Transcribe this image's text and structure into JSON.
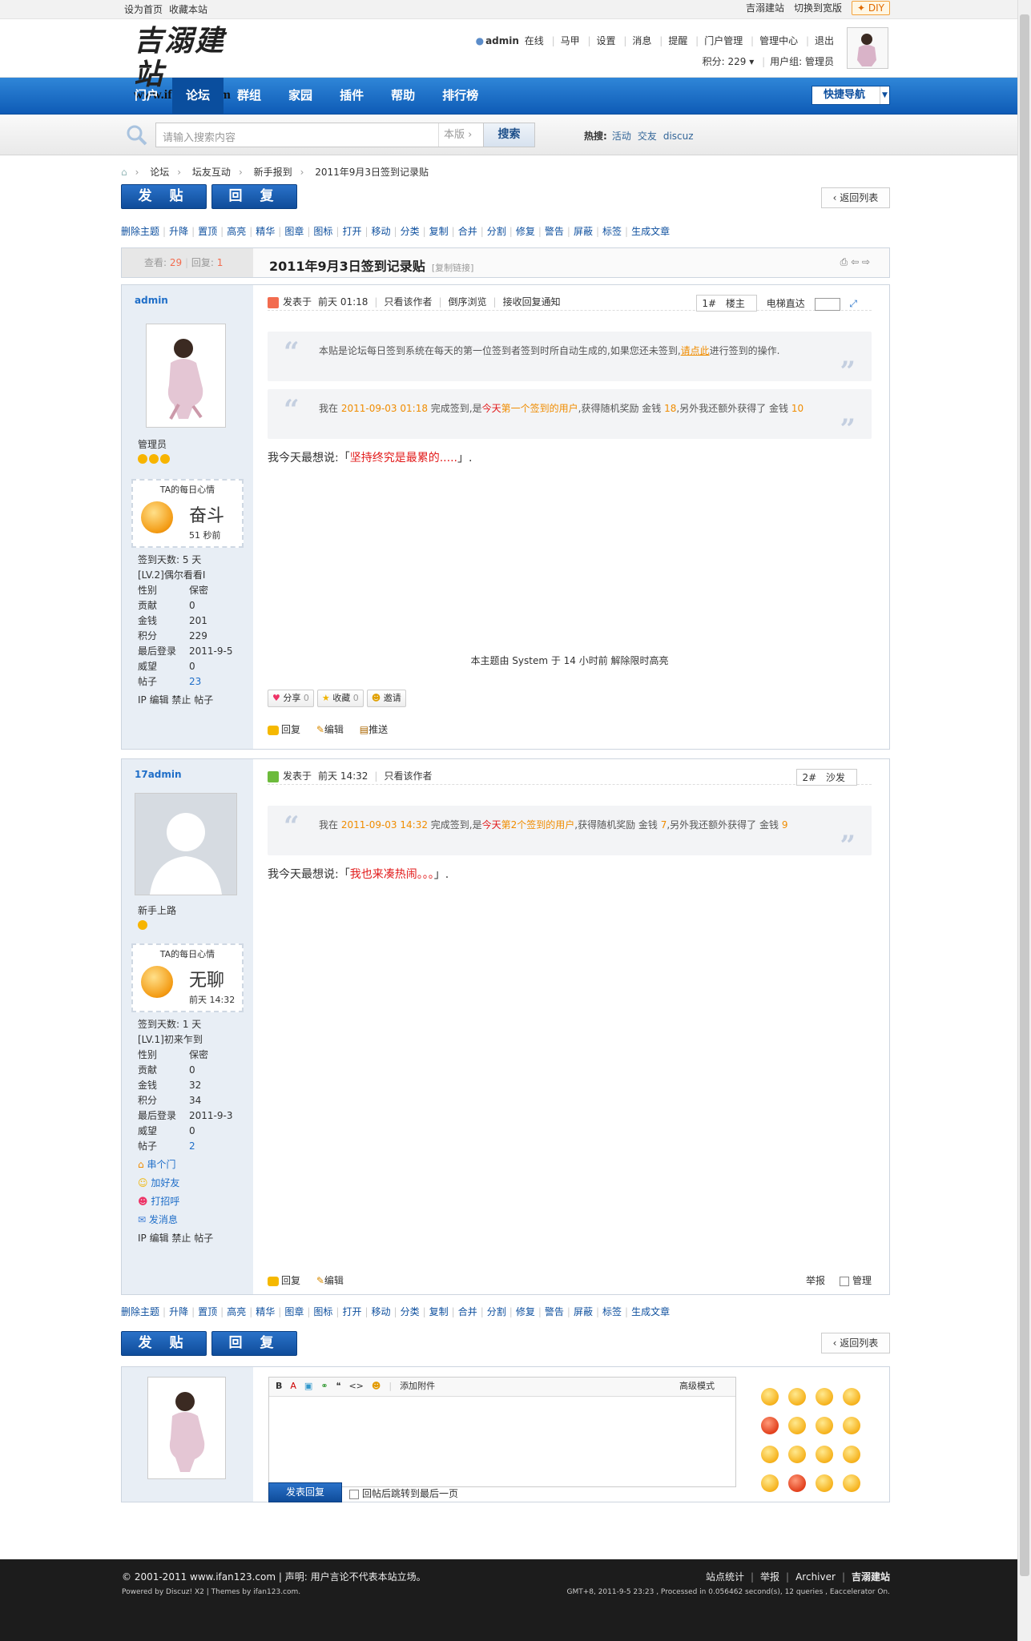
{
  "topbar": {
    "set_home": "设为首页",
    "bookmark": "收藏本站",
    "jimi": "吉溺建站",
    "wide": "切换到宽版",
    "diy": "DIY"
  },
  "header": {
    "logo_cn": "吉溺建站",
    "logo_en": "www.ifan123.com",
    "user": "admin",
    "online": "在线",
    "jia": "马甲",
    "settings": "设置",
    "messages": "消息",
    "remind": "提醒",
    "portal_admin": "门户管理",
    "admin_center": "管理中心",
    "logout": "退出",
    "points": "积分: 229",
    "usergroup": "用户组: 管理员"
  },
  "nav": {
    "items": [
      "门户",
      "论坛",
      "群组",
      "家园",
      "插件",
      "帮助",
      "排行榜"
    ],
    "active": 1,
    "quick": "快捷导航"
  },
  "search": {
    "placeholder": "请输入搜索内容",
    "scope": "本版",
    "button": "搜索",
    "hot_label": "热搜:",
    "hot": [
      "活动",
      "交友",
      "discuz"
    ]
  },
  "breadcrumb": [
    "论坛",
    "坛友互动",
    "新手报到",
    "2011年9月3日签到记录贴"
  ],
  "buttons": {
    "post": "发 贴",
    "reply": "回 复",
    "back": "返回列表"
  },
  "modbar": [
    "删除主题",
    "升降",
    "置顶",
    "高亮",
    "精华",
    "图章",
    "图标",
    "打开",
    "移动",
    "分类",
    "复制",
    "合并",
    "分割",
    "修复",
    "警告",
    "屏蔽",
    "标签",
    "生成文章"
  ],
  "thread": {
    "views_label": "查看:",
    "views": "29",
    "replies_label": "回复:",
    "replies": "1",
    "title": "2011年9月3日签到记录贴",
    "copy": "[复制链接]"
  },
  "post1": {
    "author": "admin",
    "group": "管理员",
    "mood_title": "TA的每日心情",
    "mood": "奋斗",
    "mood_time": "51 秒前",
    "checkin_days": "签到天数: 5 天",
    "level": "[LV.2]偶尔看看I",
    "stats": [
      [
        "性别",
        "保密"
      ],
      [
        "贡献",
        "0"
      ],
      [
        "金钱",
        "201"
      ],
      [
        "积分",
        "229"
      ],
      [
        "最后登录",
        "2011-9-5"
      ],
      [
        "威望",
        "0"
      ],
      [
        "帖子",
        "23"
      ]
    ],
    "actions": "IP  编辑  禁止  帖子",
    "posted": "发表于",
    "time": "前天 01:18",
    "only_author": "只看该作者",
    "reverse": "倒序浏览",
    "notify": "接收回复通知",
    "floor": "1#",
    "floor_label": "楼主",
    "jump": "电梯直达",
    "quote1": "本贴是论坛每日签到系统在每天的第一位签到者签到时所自动生成的,如果您还未签到,",
    "quote1_link": "请点此",
    "quote1_tail": "进行签到的操作.",
    "quote2_a": "我在 ",
    "quote2_time": "2011-09-03 01:18",
    "quote2_b": " 完成签到,是",
    "quote2_rank": "今天",
    "quote2_rank2": "第一个签到的用户",
    "quote2_c": ",获得随机奖励 金钱 ",
    "quote2_money": "18",
    "quote2_d": ",另外我还额外获得了 金钱 ",
    "quote2_extra": "10",
    "say_pre": "我今天最想说:「",
    "say": "坚持终究是最累的.....",
    "say_post": "」.",
    "notice": "本主题由 System 于 14 小时前 解除限时高亮",
    "share": "分享",
    "share_n": "0",
    "fav": "收藏",
    "fav_n": "0",
    "invite": "邀请",
    "reply": "回复",
    "edit": "编辑",
    "push": "推送"
  },
  "post2": {
    "author": "17admin",
    "group": "新手上路",
    "mood_title": "TA的每日心情",
    "mood": "无聊",
    "mood_time": "前天 14:32",
    "checkin_days": "签到天数: 1 天",
    "level": "[LV.1]初来乍到",
    "stats": [
      [
        "性别",
        "保密"
      ],
      [
        "贡献",
        "0"
      ],
      [
        "金钱",
        "32"
      ],
      [
        "积分",
        "34"
      ],
      [
        "最后登录",
        "2011-9-3"
      ],
      [
        "威望",
        "0"
      ],
      [
        "帖子",
        "2"
      ]
    ],
    "links": [
      "串个门",
      "加好友",
      "打招呼",
      "发消息"
    ],
    "actions": "IP  编辑  禁止  帖子",
    "posted": "发表于",
    "time": "前天 14:32",
    "only_author": "只看该作者",
    "floor": "2#",
    "floor_label": "沙发",
    "q_a": "我在 ",
    "q_time": "2011-09-03 14:32",
    "q_b": " 完成签到,是",
    "q_rank": "今天",
    "q_rank2": "第2个签到的用户",
    "q_c": ",获得随机奖励 金钱 ",
    "q_money": "7",
    "q_d": ",另外我还额外获得了 金钱 ",
    "q_extra": "9",
    "say_pre": "我今天最想说:「",
    "say": "我也来凑热闹。。。",
    "say_post": "」.",
    "reply": "回复",
    "edit": "编辑",
    "report": "举报",
    "manage": "管理"
  },
  "editor": {
    "attach": "添加附件",
    "advanced": "高级模式",
    "submit": "发表回复",
    "jump_last": "回帖后跳转到最后一页"
  },
  "footer": {
    "copyright": "© 2001-2011 www.ifan123.com | 声明: 用户言论不代表本站立场。",
    "powered": "Powered by Discuz! X2 | Themes by ifan123.com.",
    "links": [
      "站点统计",
      "举报",
      "Archiver",
      "吉溺建站"
    ],
    "stats": "GMT+8, 2011-9-5 23:23 , Processed in 0.056462 second(s), 12 queries , Eaccelerator On."
  }
}
